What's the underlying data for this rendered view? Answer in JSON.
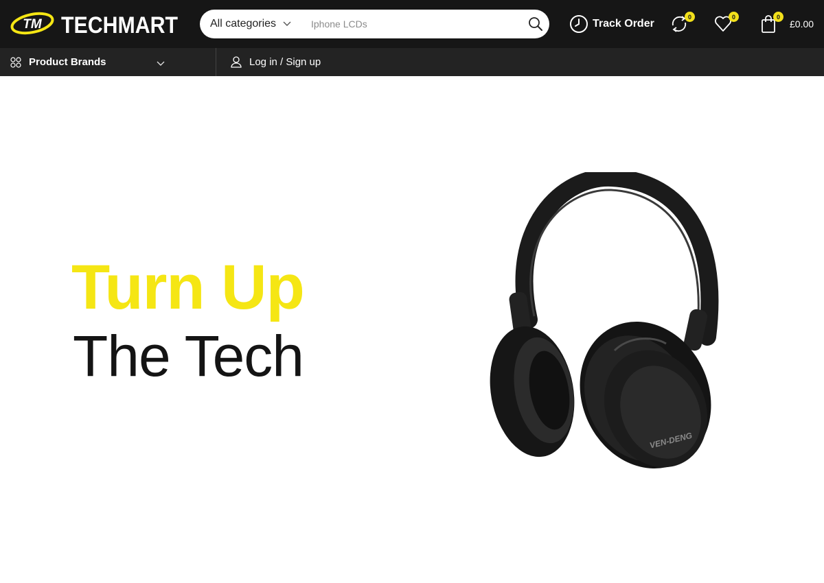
{
  "header": {
    "logo": {
      "mark": "TM",
      "name": "TECHMART"
    },
    "search": {
      "category_selected": "All categories",
      "placeholder": "Iphone LCDs"
    },
    "track_order_label": "Track Order",
    "compare_count": "0",
    "wishlist_count": "0",
    "cart_count": "0",
    "cart_total": "£0.00",
    "colors": {
      "header_bg": "#161616",
      "accent_yellow": "#f2e01b"
    }
  },
  "nav": {
    "brands_label": "Product Brands",
    "login_label": "Log in / Sign up"
  },
  "hero": {
    "line1": "Turn Up",
    "line2": "The Tech",
    "product_brand_text": "VEN-DENG",
    "colors": {
      "line1": "#f5e614",
      "line2": "#141414"
    }
  },
  "icons": {
    "cat_chevron": "chevron-down-icon",
    "search": "search-icon",
    "track": "clock-icon",
    "compare": "compare-arrows-icon",
    "wishlist": "heart-icon",
    "cart": "shopping-bag-icon",
    "brands": "grid-circles-icon",
    "login": "user-icon"
  }
}
